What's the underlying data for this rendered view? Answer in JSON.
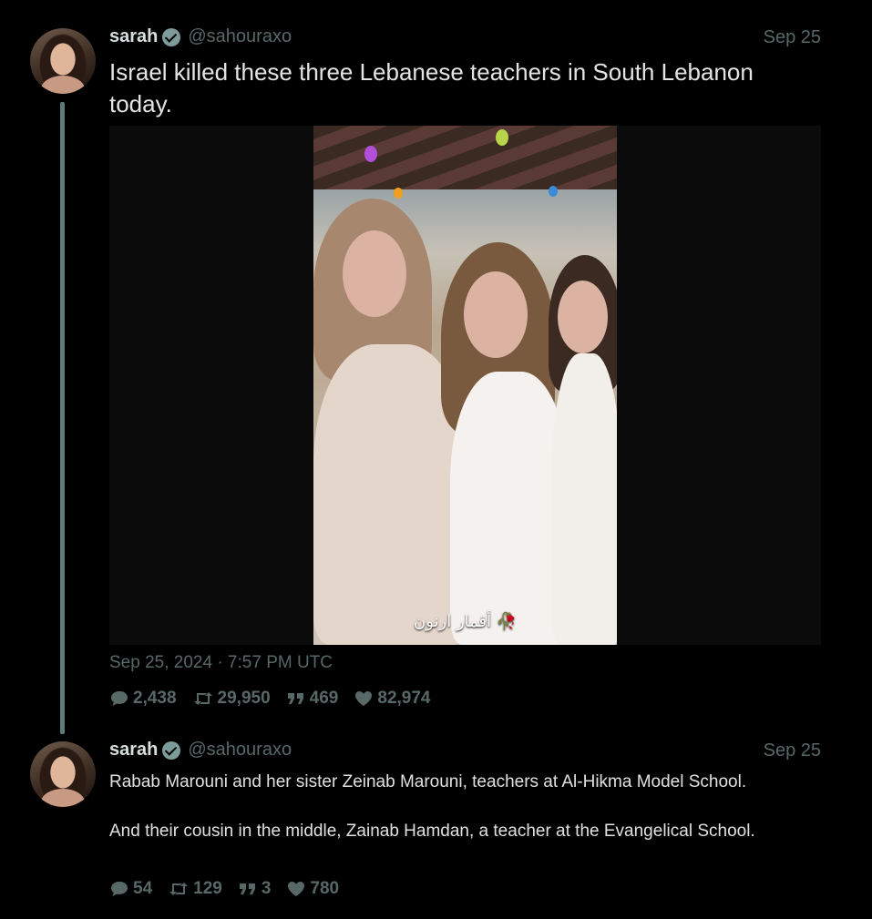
{
  "posts": [
    {
      "name": "sarah",
      "handle": "@sahouraxo",
      "date": "Sep 25",
      "text": "Israel killed these three Lebanese teachers in South Lebanon today.",
      "media": {
        "caption": "أقمار ارنون 🥀"
      },
      "timestamp": "Sep 25, 2024 · 7:57 PM UTC",
      "stats": {
        "replies": "2,438",
        "retweets": "29,950",
        "quotes": "469",
        "likes": "82,974"
      }
    },
    {
      "name": "sarah",
      "handle": "@sahouraxo",
      "date": "Sep 25",
      "paragraphs": [
        "Rabab Marouni and her sister Zeinab Marouni, teachers at Al-Hikma Model School.",
        "And their cousin in the middle, Zainab Hamdan, a teacher at the Evangelical School."
      ],
      "stats": {
        "replies": "54",
        "retweets": "129",
        "quotes": "3",
        "likes": "780"
      }
    }
  ],
  "icons": {
    "verified": "verified-badge-icon",
    "reply": "speech-bubble-icon",
    "retweet": "retweet-arrows-icon",
    "quote": "quote-marks-icon",
    "like": "heart-icon"
  },
  "colors": {
    "background": "#000000",
    "muted": "#586867",
    "accent": "#7d9b9a",
    "thread_line": "#5f7a78"
  }
}
